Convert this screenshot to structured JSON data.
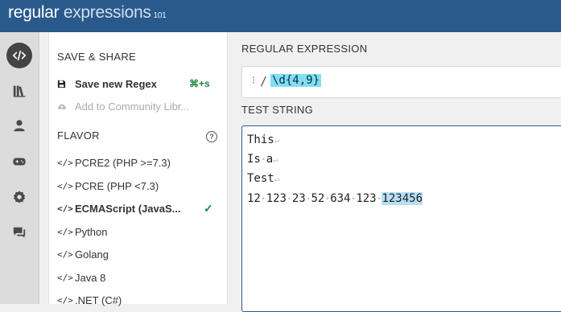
{
  "header": {
    "logo_part1": "regular",
    "logo_part2": " expressions",
    "logo_version": "101"
  },
  "rail": [
    {
      "name": "editor-icon"
    },
    {
      "name": "library-icon"
    },
    {
      "name": "account-icon"
    },
    {
      "name": "quiz-icon"
    },
    {
      "name": "settings-icon"
    },
    {
      "name": "chat-icon"
    }
  ],
  "sidebar": {
    "save_title": "SAVE & SHARE",
    "save_new": "Save new Regex",
    "save_shortcut": "⌘+s",
    "community": "Add to Community Libr...",
    "flavor_title": "FLAVOR",
    "flavors": [
      {
        "label": "PCRE2 (PHP >=7.3)",
        "selected": false
      },
      {
        "label": "PCRE (PHP <7.3)",
        "selected": false
      },
      {
        "label": "ECMAScript (JavaS...",
        "selected": true
      },
      {
        "label": "Python",
        "selected": false
      },
      {
        "label": "Golang",
        "selected": false
      },
      {
        "label": "Java 8",
        "selected": false
      },
      {
        "label": ".NET (C#)",
        "selected": false
      }
    ]
  },
  "main": {
    "regex_title": "REGULAR EXPRESSION",
    "regex_delimiter": "/",
    "regex_pattern": "\\d{4,9}",
    "test_title": "TEST STRING",
    "test_lines": [
      [
        {
          "t": "This"
        }
      ],
      [
        {
          "t": "Is"
        },
        {
          "sp": true
        },
        {
          "t": "a"
        }
      ],
      [
        {
          "t": "Test"
        }
      ],
      [
        {
          "t": "12"
        },
        {
          "sp": true
        },
        {
          "t": "123"
        },
        {
          "sp": true
        },
        {
          "t": "23"
        },
        {
          "sp": true
        },
        {
          "t": "52"
        },
        {
          "sp": true
        },
        {
          "t": "634"
        },
        {
          "sp": true
        },
        {
          "t": "123"
        },
        {
          "sp": true
        },
        {
          "t": "123456",
          "match": true
        }
      ]
    ]
  },
  "colors": {
    "topbar": "#2a5a8c",
    "match_regex": "#7fdff3",
    "match_text": "#b6dff6",
    "accent_green": "#1e8a3c"
  }
}
